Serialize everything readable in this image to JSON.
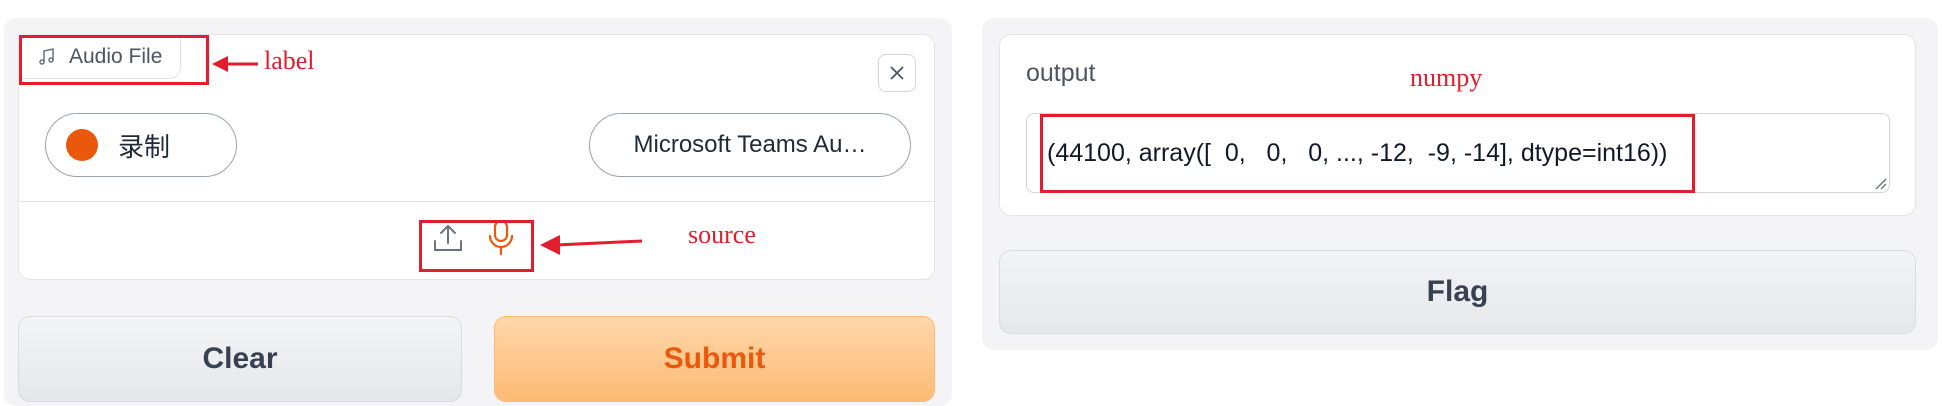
{
  "input_panel": {
    "label": "Audio File",
    "record_button_label": "录制",
    "device_select_value": "Microsoft Teams Au…",
    "clear_label": "Clear",
    "submit_label": "Submit"
  },
  "output_panel": {
    "label": "output",
    "value": "(44100, array([  0,   0,   0, ..., -12,  -9, -14], dtype=int16))",
    "flag_label": "Flag"
  },
  "annotations": {
    "label": "label",
    "source": "source",
    "numpy": "numpy"
  },
  "icons": {
    "audio_file": "music-note-icon",
    "close": "close-icon",
    "upload": "upload-icon",
    "microphone": "microphone-icon"
  },
  "colors": {
    "accent": "#ea580c",
    "annotation_red": "#e11d2e",
    "submit_bg": "#fdba74"
  }
}
